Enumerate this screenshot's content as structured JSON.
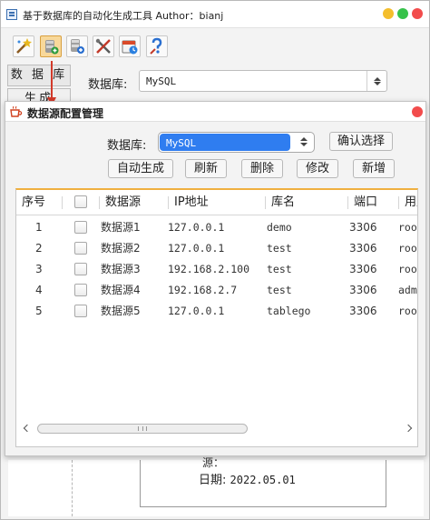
{
  "main_window": {
    "title": "基于数据库的自动化生成工具  Author：bianj",
    "toolbar": {
      "icons": [
        "magic-wand-icon",
        "database-icon",
        "database-add-icon",
        "tools-icon",
        "calendar-icon",
        "help-icon"
      ]
    },
    "tabs": [
      "数 据 库",
      "生成"
    ],
    "db_label": "数据库:",
    "db_value": "MySQL",
    "bottom": {
      "cut_text": "源：",
      "date_label": "日期:",
      "date_value": "2022.05.01"
    }
  },
  "dialog": {
    "title": "数据源配置管理",
    "db_label": "数据库:",
    "db_value": "MySQL",
    "buttons": {
      "confirm": "确认选择",
      "auto_generate": "自动生成",
      "refresh": "刷新",
      "delete": "删除",
      "edit": "修改",
      "add": "新增"
    },
    "table": {
      "headers": [
        "序号",
        "",
        "数据源",
        "IP地址",
        "库名",
        "端口",
        "用户名"
      ],
      "rows": [
        {
          "no": "1",
          "name": "数据源1",
          "ip": "127.0.0.1",
          "db": "demo",
          "port": "3306",
          "user": "root"
        },
        {
          "no": "2",
          "name": "数据源2",
          "ip": "127.0.0.1",
          "db": "test",
          "port": "3306",
          "user": "root"
        },
        {
          "no": "3",
          "name": "数据源3",
          "ip": "192.168.2.100",
          "db": "test",
          "port": "3306",
          "user": "root"
        },
        {
          "no": "4",
          "name": "数据源4",
          "ip": "192.168.2.7",
          "db": "test",
          "port": "3306",
          "user": "admin"
        },
        {
          "no": "5",
          "name": "数据源5",
          "ip": "127.0.0.1",
          "db": "tablego",
          "port": "3306",
          "user": "root"
        }
      ]
    }
  },
  "colors": {
    "accent_blue": "#2f7df0",
    "table_top_border": "#f0b040",
    "close_red": "#f24c4c",
    "minimize_yellow": "#f4be2c",
    "maximize_green": "#36c24a",
    "connector_arrow": "#d23a2a"
  }
}
